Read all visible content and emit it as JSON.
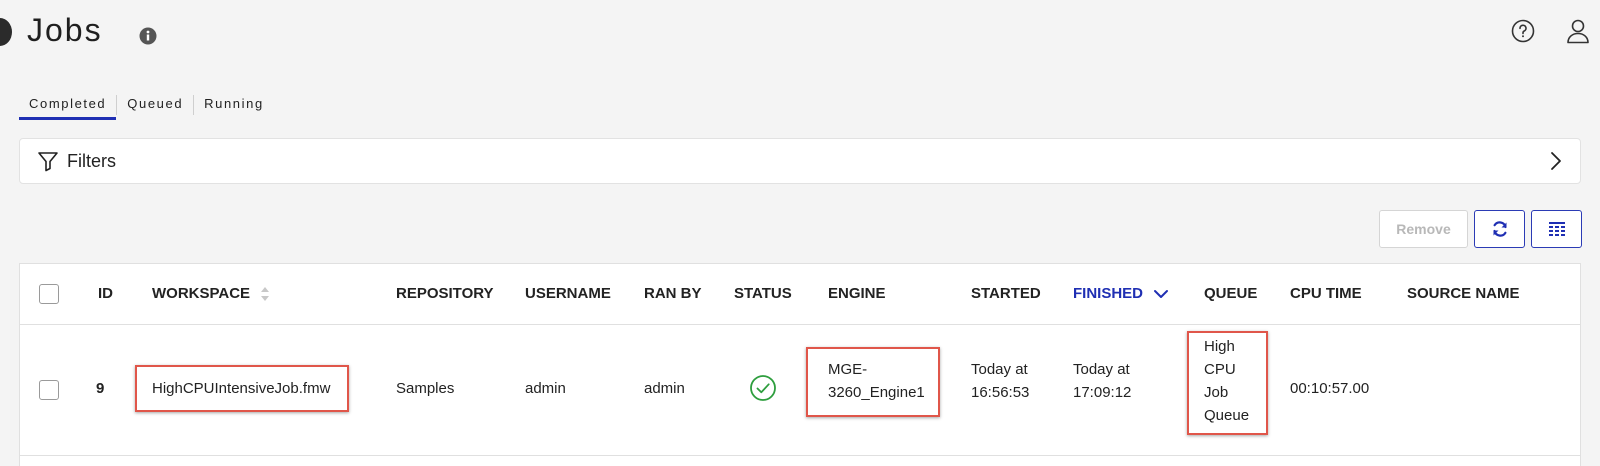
{
  "header": {
    "title": "Jobs"
  },
  "tabs": [
    {
      "label": "Completed",
      "active": true
    },
    {
      "label": "Queued",
      "active": false
    },
    {
      "label": "Running",
      "active": false
    }
  ],
  "filters": {
    "label": "Filters"
  },
  "toolbar": {
    "remove_label": "Remove"
  },
  "table": {
    "columns": {
      "id": "ID",
      "workspace": "WORKSPACE",
      "repository": "REPOSITORY",
      "username": "USERNAME",
      "ran_by": "RAN BY",
      "status": "STATUS",
      "engine": "ENGINE",
      "started": "STARTED",
      "finished": "FINISHED",
      "queue": "QUEUE",
      "cpu_time": "CPU TIME",
      "source_name": "SOURCE NAME"
    },
    "sorted_column": "finished",
    "sort_direction": "descending",
    "rows": [
      {
        "id": "9",
        "workspace": "HighCPUIntensiveJob.fmw",
        "repository": "Samples",
        "username": "admin",
        "ran_by": "admin",
        "status": "success",
        "engine_line1": "MGE-",
        "engine_line2": "3260_Engine1",
        "started_line1": "Today at",
        "started_line2": "16:56:53",
        "finished_line1": "Today at",
        "finished_line2": "17:09:12",
        "queue_lines": [
          "High",
          "CPU",
          "Job",
          "Queue"
        ],
        "cpu_time": "00:10:57.00",
        "source_name": ""
      }
    ]
  },
  "colors": {
    "accent": "#1f2fb3",
    "highlight_box": "#e0564a",
    "status_success": "#2e9e3e"
  },
  "icons": {
    "info": "info-icon",
    "help": "help-icon",
    "user": "user-icon",
    "filter": "filter-icon",
    "refresh": "refresh-icon",
    "columns": "columns-icon",
    "status": "check-circle-icon"
  }
}
